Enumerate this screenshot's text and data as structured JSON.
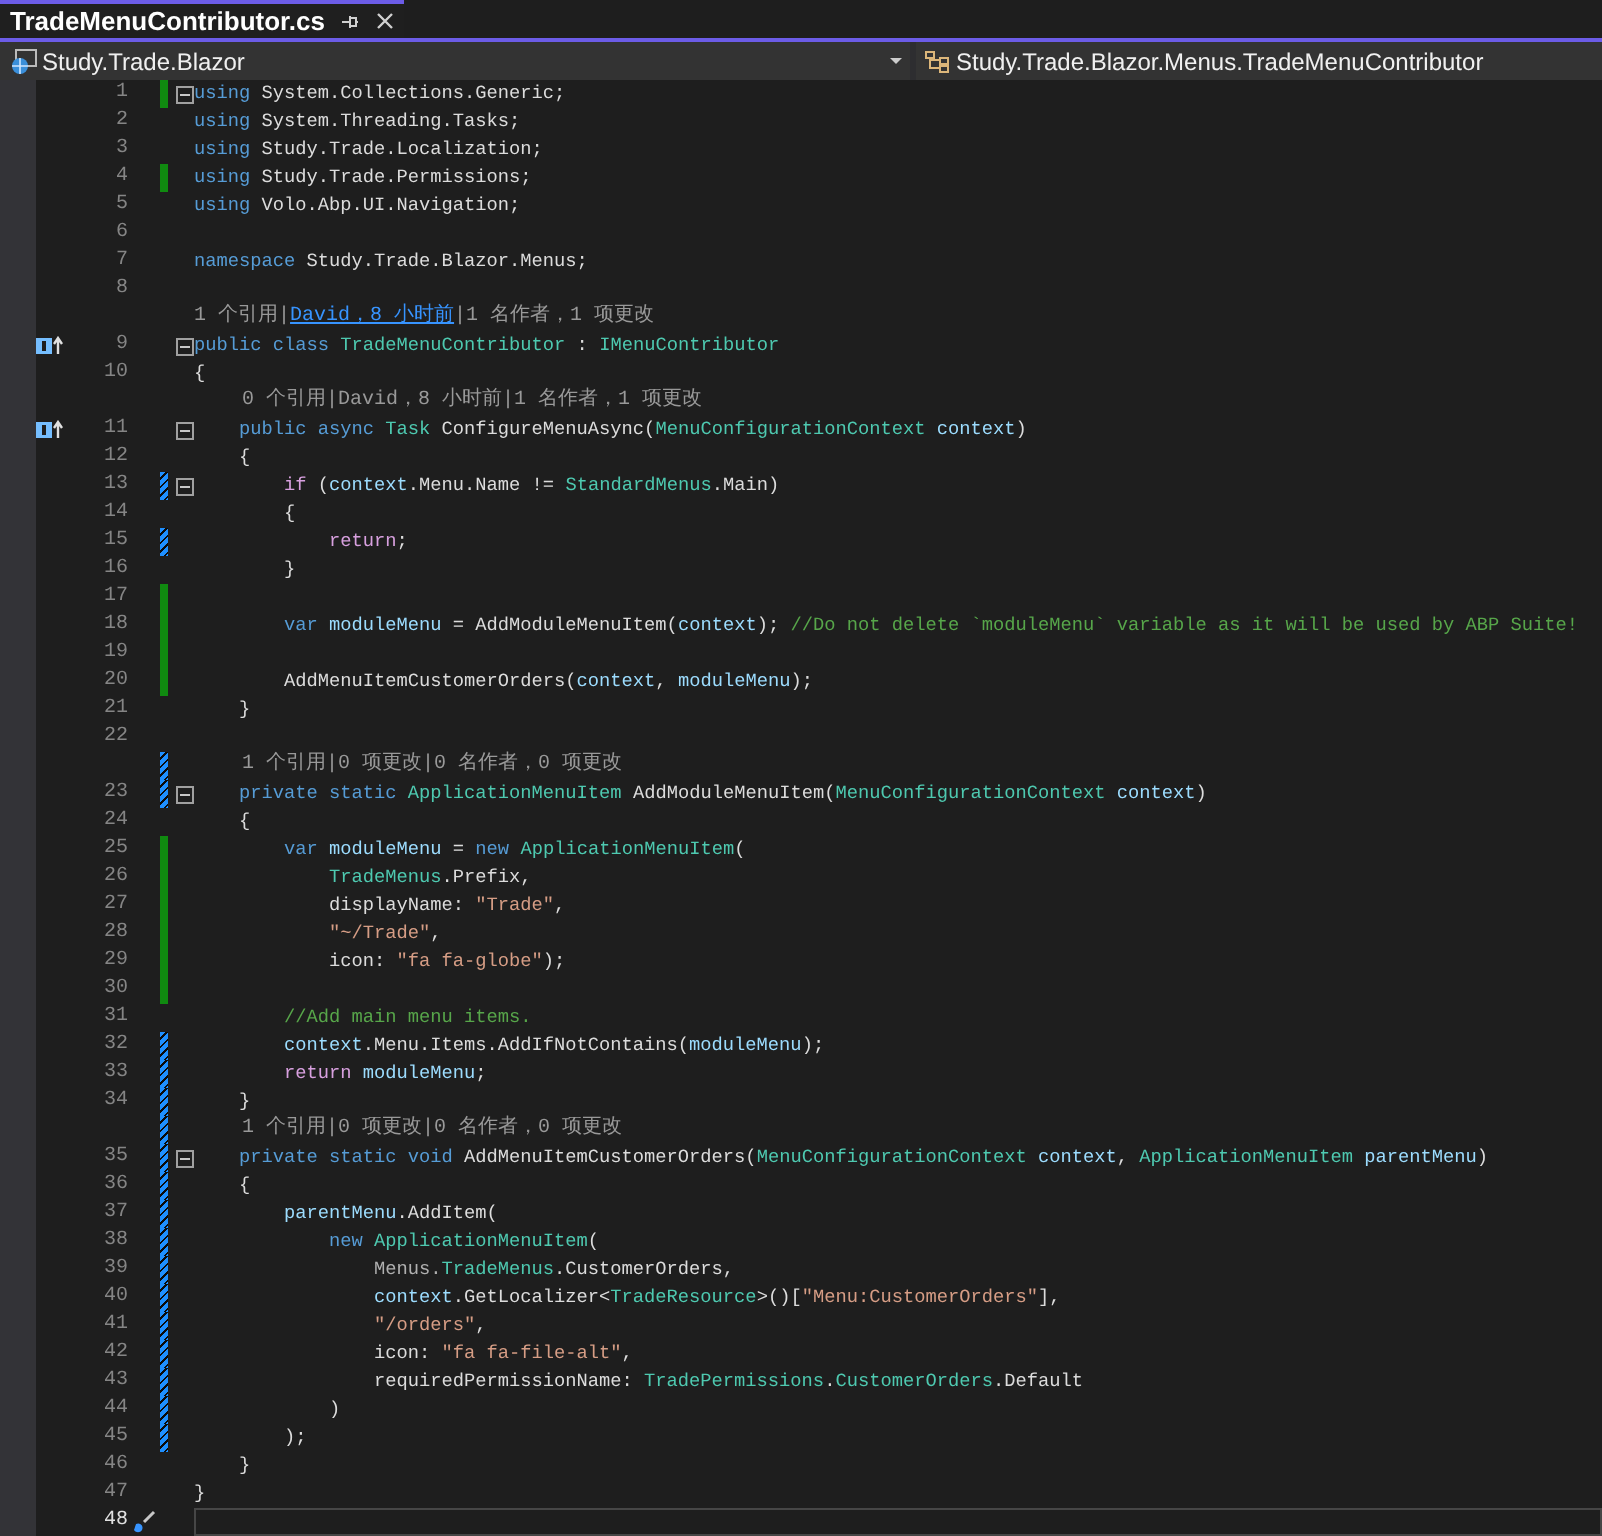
{
  "tab": {
    "title": "TradeMenuContributor.cs"
  },
  "navigation": {
    "project": "Study.Trade.Blazor",
    "member": "Study.Trade.Blazor.Menus.TradeMenuContributor"
  },
  "lines": [
    {
      "kind": "code",
      "number": "1",
      "saved_change": true,
      "unsaved_change": false,
      "fold": true,
      "implements": false,
      "quick_action": false,
      "current": false,
      "tokens": [
        {
          "kind": "kw",
          "text": "using"
        },
        {
          "kind": "plain",
          "text": " System.Collections.Generic;"
        }
      ]
    },
    {
      "kind": "code",
      "number": "2",
      "saved_change": false,
      "unsaved_change": false,
      "fold": false,
      "implements": false,
      "quick_action": false,
      "current": false,
      "tokens": [
        {
          "kind": "kw",
          "text": "using"
        },
        {
          "kind": "plain",
          "text": " System.Threading.Tasks;"
        }
      ]
    },
    {
      "kind": "code",
      "number": "3",
      "saved_change": false,
      "unsaved_change": false,
      "fold": false,
      "implements": false,
      "quick_action": false,
      "current": false,
      "tokens": [
        {
          "kind": "kw",
          "text": "using"
        },
        {
          "kind": "plain",
          "text": " Study.Trade.Localization;"
        }
      ]
    },
    {
      "kind": "code",
      "number": "4",
      "saved_change": true,
      "unsaved_change": false,
      "fold": false,
      "implements": false,
      "quick_action": false,
      "current": false,
      "tokens": [
        {
          "kind": "kw",
          "text": "using"
        },
        {
          "kind": "plain",
          "text": " Study.Trade.Permissions;"
        }
      ]
    },
    {
      "kind": "code",
      "number": "5",
      "saved_change": false,
      "unsaved_change": false,
      "fold": false,
      "implements": false,
      "quick_action": false,
      "current": false,
      "tokens": [
        {
          "kind": "kw",
          "text": "using"
        },
        {
          "kind": "plain",
          "text": " Volo.Abp.UI.Navigation;"
        }
      ]
    },
    {
      "kind": "code",
      "number": "6",
      "saved_change": false,
      "unsaved_change": false,
      "fold": false,
      "implements": false,
      "quick_action": false,
      "current": false
    },
    {
      "kind": "code",
      "number": "7",
      "saved_change": false,
      "unsaved_change": false,
      "fold": false,
      "implements": false,
      "quick_action": false,
      "current": false,
      "tokens": [
        {
          "kind": "kw",
          "text": "namespace"
        },
        {
          "kind": "plain",
          "text": " Study.Trade.Blazor.Menus;"
        }
      ]
    },
    {
      "kind": "code",
      "number": "8",
      "saved_change": false,
      "unsaved_change": false,
      "fold": false,
      "implements": false,
      "quick_action": false,
      "current": false
    },
    {
      "kind": "lens",
      "saved_change": false,
      "unsaved_change": false,
      "tokens": [
        {
          "kind": "lens",
          "text": "1 个引用|"
        },
        {
          "kind": "link",
          "text": "David，8 小时前"
        },
        {
          "kind": "lens",
          "text": "|1 名作者，1 项更改"
        }
      ]
    },
    {
      "kind": "code",
      "number": "9",
      "saved_change": false,
      "unsaved_change": false,
      "fold": true,
      "implements": true,
      "quick_action": false,
      "current": false,
      "tokens": [
        {
          "kind": "kw",
          "text": "public class "
        },
        {
          "kind": "type",
          "text": "TradeMenuContributor"
        },
        {
          "kind": "plain",
          "text": " : "
        },
        {
          "kind": "type",
          "text": "IMenuContributor"
        }
      ]
    },
    {
      "kind": "code",
      "number": "10",
      "saved_change": false,
      "unsaved_change": false,
      "fold": false,
      "implements": false,
      "quick_action": false,
      "current": false,
      "tokens": [
        {
          "kind": "plain",
          "text": "{"
        }
      ]
    },
    {
      "kind": "lens",
      "saved_change": false,
      "unsaved_change": false,
      "tokens": [
        {
          "kind": "lens",
          "text": "    0 个引用|David，8 小时前|1 名作者，1 项更改"
        }
      ]
    },
    {
      "kind": "code",
      "number": "11",
      "saved_change": false,
      "unsaved_change": false,
      "fold": true,
      "implements": true,
      "quick_action": false,
      "current": false,
      "tokens": [
        {
          "kind": "kw",
          "text": "    public async "
        },
        {
          "kind": "type",
          "text": "Task"
        },
        {
          "kind": "plain",
          "text": " ConfigureMenuAsync("
        },
        {
          "kind": "type",
          "text": "MenuConfigurationContext"
        },
        {
          "kind": "var",
          "text": " context"
        },
        {
          "kind": "plain",
          "text": ")"
        }
      ]
    },
    {
      "kind": "code",
      "number": "12",
      "saved_change": false,
      "unsaved_change": false,
      "fold": false,
      "implements": false,
      "quick_action": false,
      "current": false,
      "tokens": [
        {
          "kind": "plain",
          "text": "    {"
        }
      ]
    },
    {
      "kind": "code",
      "number": "13",
      "saved_change": false,
      "unsaved_change": true,
      "fold": true,
      "implements": false,
      "quick_action": false,
      "current": false,
      "tokens": [
        {
          "kind": "ctl",
          "text": "        if"
        },
        {
          "kind": "plain",
          "text": " ("
        },
        {
          "kind": "var",
          "text": "context"
        },
        {
          "kind": "plain",
          "text": ".Menu.Name != "
        },
        {
          "kind": "type",
          "text": "StandardMenus"
        },
        {
          "kind": "plain",
          "text": ".Main)"
        }
      ]
    },
    {
      "kind": "code",
      "number": "14",
      "saved_change": false,
      "unsaved_change": false,
      "fold": false,
      "implements": false,
      "quick_action": false,
      "current": false,
      "tokens": [
        {
          "kind": "plain",
          "text": "        {"
        }
      ]
    },
    {
      "kind": "code",
      "number": "15",
      "saved_change": false,
      "unsaved_change": true,
      "fold": false,
      "implements": false,
      "quick_action": false,
      "current": false,
      "tokens": [
        {
          "kind": "ctl",
          "text": "            return"
        },
        {
          "kind": "plain",
          "text": ";"
        }
      ]
    },
    {
      "kind": "code",
      "number": "16",
      "saved_change": false,
      "unsaved_change": false,
      "fold": false,
      "implements": false,
      "quick_action": false,
      "current": false,
      "tokens": [
        {
          "kind": "plain",
          "text": "        }"
        }
      ]
    },
    {
      "kind": "code",
      "number": "17",
      "saved_change": true,
      "unsaved_change": false,
      "fold": false,
      "implements": false,
      "quick_action": false,
      "current": false
    },
    {
      "kind": "code",
      "number": "18",
      "saved_change": true,
      "unsaved_change": false,
      "fold": false,
      "implements": false,
      "quick_action": false,
      "current": false,
      "tokens": [
        {
          "kind": "kw",
          "text": "        var"
        },
        {
          "kind": "var",
          "text": " moduleMenu"
        },
        {
          "kind": "plain",
          "text": " = AddModuleMenuItem("
        },
        {
          "kind": "var",
          "text": "context"
        },
        {
          "kind": "plain",
          "text": "); "
        },
        {
          "kind": "cmt",
          "text": "//Do not delete `moduleMenu` variable as it will be used by ABP Suite!"
        }
      ]
    },
    {
      "kind": "code",
      "number": "19",
      "saved_change": true,
      "unsaved_change": false,
      "fold": false,
      "implements": false,
      "quick_action": false,
      "current": false
    },
    {
      "kind": "code",
      "number": "20",
      "saved_change": true,
      "unsaved_change": false,
      "fold": false,
      "implements": false,
      "quick_action": false,
      "current": false,
      "tokens": [
        {
          "kind": "plain",
          "text": "        AddMenuItemCustomerOrders("
        },
        {
          "kind": "var",
          "text": "context"
        },
        {
          "kind": "plain",
          "text": ", "
        },
        {
          "kind": "var",
          "text": "moduleMenu"
        },
        {
          "kind": "plain",
          "text": ");"
        }
      ]
    },
    {
      "kind": "code",
      "number": "21",
      "saved_change": false,
      "unsaved_change": false,
      "fold": false,
      "implements": false,
      "quick_action": false,
      "current": false,
      "tokens": [
        {
          "kind": "plain",
          "text": "    }"
        }
      ]
    },
    {
      "kind": "code",
      "number": "22",
      "saved_change": false,
      "unsaved_change": false,
      "fold": false,
      "implements": false,
      "quick_action": false,
      "current": false
    },
    {
      "kind": "lens",
      "saved_change": false,
      "unsaved_change": true,
      "tokens": [
        {
          "kind": "lens",
          "text": "    1 个引用|0 项更改|0 名作者，0 项更改"
        }
      ]
    },
    {
      "kind": "code",
      "number": "23",
      "saved_change": false,
      "unsaved_change": true,
      "fold": true,
      "implements": false,
      "quick_action": false,
      "current": false,
      "tokens": [
        {
          "kind": "kw",
          "text": "    private static "
        },
        {
          "kind": "type",
          "text": "ApplicationMenuItem"
        },
        {
          "kind": "plain",
          "text": " AddModuleMenuItem("
        },
        {
          "kind": "type",
          "text": "MenuConfigurationContext"
        },
        {
          "kind": "var",
          "text": " context"
        },
        {
          "kind": "plain",
          "text": ")"
        }
      ]
    },
    {
      "kind": "code",
      "number": "24",
      "saved_change": false,
      "unsaved_change": false,
      "fold": false,
      "implements": false,
      "quick_action": false,
      "current": false,
      "tokens": [
        {
          "kind": "plain",
          "text": "    {"
        }
      ]
    },
    {
      "kind": "code",
      "number": "25",
      "saved_change": true,
      "unsaved_change": false,
      "fold": false,
      "implements": false,
      "quick_action": false,
      "current": false,
      "tokens": [
        {
          "kind": "kw",
          "text": "        var"
        },
        {
          "kind": "var",
          "text": " moduleMenu"
        },
        {
          "kind": "plain",
          "text": " = "
        },
        {
          "kind": "kw",
          "text": "new "
        },
        {
          "kind": "type",
          "text": "ApplicationMenuItem"
        },
        {
          "kind": "plain",
          "text": "("
        }
      ]
    },
    {
      "kind": "code",
      "number": "26",
      "saved_change": true,
      "unsaved_change": false,
      "fold": false,
      "implements": false,
      "quick_action": false,
      "current": false,
      "tokens": [
        {
          "kind": "type",
          "text": "            TradeMenus"
        },
        {
          "kind": "plain",
          "text": ".Prefix,"
        }
      ]
    },
    {
      "kind": "code",
      "number": "27",
      "saved_change": true,
      "unsaved_change": false,
      "fold": false,
      "implements": false,
      "quick_action": false,
      "current": false,
      "tokens": [
        {
          "kind": "plain",
          "text": "            displayName: "
        },
        {
          "kind": "str",
          "text": "\"Trade\""
        },
        {
          "kind": "plain",
          "text": ","
        }
      ]
    },
    {
      "kind": "code",
      "number": "28",
      "saved_change": true,
      "unsaved_change": false,
      "fold": false,
      "implements": false,
      "quick_action": false,
      "current": false,
      "tokens": [
        {
          "kind": "str",
          "text": "            \"~/Trade\""
        },
        {
          "kind": "plain",
          "text": ","
        }
      ]
    },
    {
      "kind": "code",
      "number": "29",
      "saved_change": true,
      "unsaved_change": false,
      "fold": false,
      "implements": false,
      "quick_action": false,
      "current": false,
      "tokens": [
        {
          "kind": "plain",
          "text": "            icon: "
        },
        {
          "kind": "str",
          "text": "\"fa fa-globe\""
        },
        {
          "kind": "plain",
          "text": ");"
        }
      ]
    },
    {
      "kind": "code",
      "number": "30",
      "saved_change": true,
      "unsaved_change": false,
      "fold": false,
      "implements": false,
      "quick_action": false,
      "current": false
    },
    {
      "kind": "code",
      "number": "31",
      "saved_change": false,
      "unsaved_change": false,
      "fold": false,
      "implements": false,
      "quick_action": false,
      "current": false,
      "tokens": [
        {
          "kind": "cmt",
          "text": "        //Add main menu items."
        }
      ]
    },
    {
      "kind": "code",
      "number": "32",
      "saved_change": false,
      "unsaved_change": true,
      "fold": false,
      "implements": false,
      "quick_action": false,
      "current": false,
      "tokens": [
        {
          "kind": "var",
          "text": "        context"
        },
        {
          "kind": "plain",
          "text": ".Menu.Items.AddIfNotContains("
        },
        {
          "kind": "var",
          "text": "moduleMenu"
        },
        {
          "kind": "plain",
          "text": ");"
        }
      ]
    },
    {
      "kind": "code",
      "number": "33",
      "saved_change": false,
      "unsaved_change": true,
      "fold": false,
      "implements": false,
      "quick_action": false,
      "current": false,
      "tokens": [
        {
          "kind": "ctl",
          "text": "        return"
        },
        {
          "kind": "var",
          "text": " moduleMenu"
        },
        {
          "kind": "plain",
          "text": ";"
        }
      ]
    },
    {
      "kind": "code",
      "number": "34",
      "saved_change": false,
      "unsaved_change": true,
      "fold": false,
      "implements": false,
      "quick_action": false,
      "current": false,
      "tokens": [
        {
          "kind": "plain",
          "text": "    }"
        }
      ]
    },
    {
      "kind": "lens",
      "saved_change": false,
      "unsaved_change": true,
      "tokens": [
        {
          "kind": "lens",
          "text": "    1 个引用|0 项更改|0 名作者，0 项更改"
        }
      ]
    },
    {
      "kind": "code",
      "number": "35",
      "saved_change": false,
      "unsaved_change": true,
      "fold": true,
      "implements": false,
      "quick_action": false,
      "current": false,
      "tokens": [
        {
          "kind": "kw",
          "text": "    private static void"
        },
        {
          "kind": "plain",
          "text": " AddMenuItemCustomerOrders("
        },
        {
          "kind": "type",
          "text": "MenuConfigurationContext"
        },
        {
          "kind": "var",
          "text": " context"
        },
        {
          "kind": "plain",
          "text": ", "
        },
        {
          "kind": "type",
          "text": "ApplicationMenuItem"
        },
        {
          "kind": "var",
          "text": " parentMenu"
        },
        {
          "kind": "plain",
          "text": ")"
        }
      ]
    },
    {
      "kind": "code",
      "number": "36",
      "saved_change": false,
      "unsaved_change": true,
      "fold": false,
      "implements": false,
      "quick_action": false,
      "current": false,
      "tokens": [
        {
          "kind": "plain",
          "text": "    {"
        }
      ]
    },
    {
      "kind": "code",
      "number": "37",
      "saved_change": false,
      "unsaved_change": true,
      "fold": false,
      "implements": false,
      "quick_action": false,
      "current": false,
      "tokens": [
        {
          "kind": "var",
          "text": "        parentMenu"
        },
        {
          "kind": "plain",
          "text": ".AddItem("
        }
      ]
    },
    {
      "kind": "code",
      "number": "38",
      "saved_change": false,
      "unsaved_change": true,
      "fold": false,
      "implements": false,
      "quick_action": false,
      "current": false,
      "tokens": [
        {
          "kind": "kw",
          "text": "            new "
        },
        {
          "kind": "type",
          "text": "ApplicationMenuItem"
        },
        {
          "kind": "plain",
          "text": "("
        }
      ]
    },
    {
      "kind": "code",
      "number": "39",
      "saved_change": false,
      "unsaved_change": true,
      "fold": false,
      "implements": false,
      "quick_action": false,
      "current": false,
      "tokens": [
        {
          "kind": "ns",
          "text": "                Menus."
        },
        {
          "kind": "type",
          "text": "TradeMenus"
        },
        {
          "kind": "plain",
          "text": ".CustomerOrders,"
        }
      ]
    },
    {
      "kind": "code",
      "number": "40",
      "saved_change": false,
      "unsaved_change": true,
      "fold": false,
      "implements": false,
      "quick_action": false,
      "current": false,
      "tokens": [
        {
          "kind": "var",
          "text": "                context"
        },
        {
          "kind": "plain",
          "text": ".GetLocalizer<"
        },
        {
          "kind": "type",
          "text": "TradeResource"
        },
        {
          "kind": "plain",
          "text": ">()["
        },
        {
          "kind": "str",
          "text": "\"Menu:CustomerOrders\""
        },
        {
          "kind": "plain",
          "text": "],"
        }
      ]
    },
    {
      "kind": "code",
      "number": "41",
      "saved_change": false,
      "unsaved_change": true,
      "fold": false,
      "implements": false,
      "quick_action": false,
      "current": false,
      "tokens": [
        {
          "kind": "str",
          "text": "                \"/orders\""
        },
        {
          "kind": "plain",
          "text": ","
        }
      ]
    },
    {
      "kind": "code",
      "number": "42",
      "saved_change": false,
      "unsaved_change": true,
      "fold": false,
      "implements": false,
      "quick_action": false,
      "current": false,
      "tokens": [
        {
          "kind": "plain",
          "text": "                icon: "
        },
        {
          "kind": "str",
          "text": "\"fa fa-file-alt\""
        },
        {
          "kind": "plain",
          "text": ","
        }
      ]
    },
    {
      "kind": "code",
      "number": "43",
      "saved_change": false,
      "unsaved_change": true,
      "fold": false,
      "implements": false,
      "quick_action": false,
      "current": false,
      "tokens": [
        {
          "kind": "plain",
          "text": "                requiredPermissionName: "
        },
        {
          "kind": "type",
          "text": "TradePermissions"
        },
        {
          "kind": "plain",
          "text": "."
        },
        {
          "kind": "type",
          "text": "CustomerOrders"
        },
        {
          "kind": "plain",
          "text": ".Default"
        }
      ]
    },
    {
      "kind": "code",
      "number": "44",
      "saved_change": false,
      "unsaved_change": true,
      "fold": false,
      "implements": false,
      "quick_action": false,
      "current": false,
      "tokens": [
        {
          "kind": "plain",
          "text": "            )"
        }
      ]
    },
    {
      "kind": "code",
      "number": "45",
      "saved_change": false,
      "unsaved_change": true,
      "fold": false,
      "implements": false,
      "quick_action": false,
      "current": false,
      "tokens": [
        {
          "kind": "plain",
          "text": "        );"
        }
      ]
    },
    {
      "kind": "code",
      "number": "46",
      "saved_change": false,
      "unsaved_change": false,
      "fold": false,
      "implements": false,
      "quick_action": false,
      "current": false,
      "tokens": [
        {
          "kind": "plain",
          "text": "    }"
        }
      ]
    },
    {
      "kind": "code",
      "number": "47",
      "saved_change": false,
      "unsaved_change": false,
      "fold": false,
      "implements": false,
      "quick_action": false,
      "current": false,
      "tokens": [
        {
          "kind": "plain",
          "text": "}"
        }
      ]
    },
    {
      "kind": "code",
      "number": "48",
      "saved_change": false,
      "unsaved_change": false,
      "fold": false,
      "implements": false,
      "quick_action": true,
      "current": true
    }
  ]
}
